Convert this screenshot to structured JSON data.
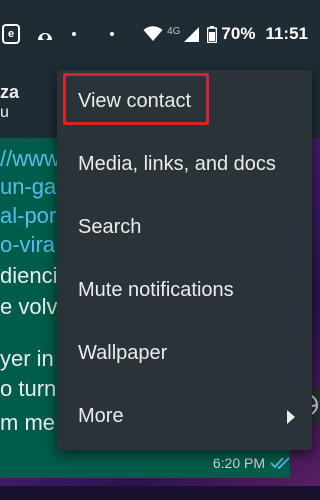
{
  "status_bar": {
    "network_type": "4G",
    "battery_percent": "70%",
    "time": "11:51",
    "icons": [
      "e-icon",
      "arc-icon",
      "dot-icon",
      "dot-icon",
      "wifi-icon",
      "signal-icon",
      "battery-icon"
    ]
  },
  "chat_header": {
    "contact_name": "za",
    "contact_subtitle": "u"
  },
  "message": {
    "lines": [
      {
        "text": "//www",
        "kind": "link"
      },
      {
        "text": "un-gat",
        "kind": "link"
      },
      {
        "text": "al-por",
        "kind": "link"
      },
      {
        "text": "o-vira",
        "kind": "link"
      },
      {
        "text": "dienci",
        "kind": "text"
      },
      {
        "text": "e volv",
        "kind": "text"
      },
      {
        "text": "yer in",
        "kind": "text"
      },
      {
        "text": "o turn",
        "kind": "text"
      },
      {
        "text": "m me",
        "kind": "text"
      }
    ],
    "time": "6:20 PM",
    "read_icon": "double-check-icon"
  },
  "menu": {
    "items": [
      {
        "label": "View contact",
        "highlighted": true
      },
      {
        "label": "Media, links, and docs"
      },
      {
        "label": "Search"
      },
      {
        "label": "Mute notifications"
      },
      {
        "label": "Wallpaper"
      },
      {
        "label": "More",
        "has_submenu": true
      }
    ]
  },
  "colors": {
    "header_bg": "#1f2c34",
    "menu_bg": "#2a3338",
    "bubble_bg": "#005c4b",
    "highlight_border": "#d8232a",
    "link": "#53bdeb",
    "read_ticks": "#53bdeb"
  }
}
